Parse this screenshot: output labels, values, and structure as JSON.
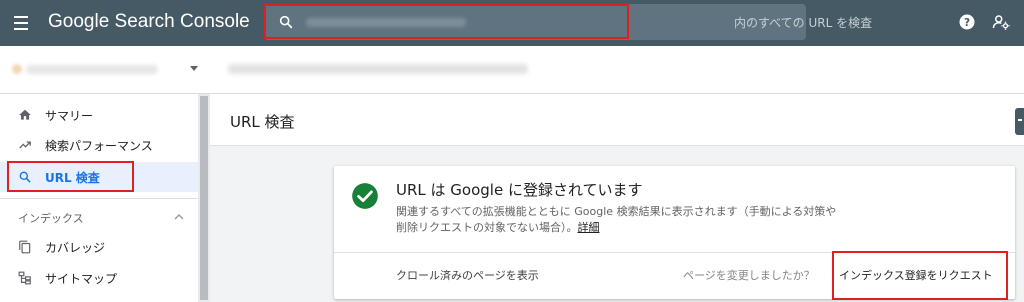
{
  "header": {
    "app_title": "Google Search Console",
    "search_placeholder": "内のすべての URL を検査",
    "menu_icon": "hamburger-icon",
    "help_icon": "help-icon",
    "account_icon": "account-settings-icon"
  },
  "sidebar": {
    "items": [
      {
        "label": "サマリー",
        "icon": "home-icon"
      },
      {
        "label": "検索パフォーマンス",
        "icon": "trending-up-icon"
      },
      {
        "label": "URL 検査",
        "icon": "search-icon",
        "active": true
      }
    ],
    "index_section": {
      "label": "インデックス",
      "items": [
        {
          "label": "カバレッジ",
          "icon": "copy-icon"
        },
        {
          "label": "サイトマップ",
          "icon": "sitemap-icon"
        }
      ]
    }
  },
  "main": {
    "page_title": "URL 検査",
    "card": {
      "status_title": "URL は Google に登録されています",
      "status_desc": "関連するすべての拡張機能とともに Google 検索結果に表示されます（手動による対策や削除リクエストの対象でない場合）。",
      "detail_link": "詳細",
      "crawled_page": "クロール済みのページを表示",
      "changed_question": "ページを変更しましたか？",
      "request_indexing": "インデックス登録をリクエスト"
    }
  },
  "colors": {
    "topbar": "#455a64",
    "success": "#188038",
    "highlight": "#e02020"
  }
}
